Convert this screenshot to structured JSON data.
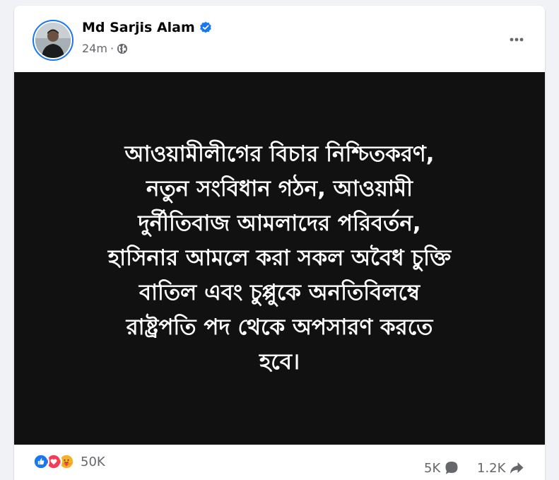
{
  "post": {
    "author": {
      "name": "Md Sarjis Alam",
      "verified": true,
      "avatar_icon": "profile-photo"
    },
    "time": "24m",
    "time_separator": "·",
    "audience_icon": "globe-icon",
    "more_icon": "more-horizontal-icon",
    "image_text": "আওয়ামীলীগের বিচার নিশ্চিতকরণ,\nনতুন সংবিধান গঠন, আওয়ামী\nদুর্নীতিবাজ আমলাদের পরিবর্তন,\nহাসিনার আমলে করা সকল অবৈধ চুক্তি\nবাতিল এবং চুপ্পুকে অনতিবিলম্বে\nরাষ্ট্রপতি পদ থেকে অপসারণ করতে\nহবে।"
  },
  "engagement": {
    "reactions": {
      "icons": [
        "like-icon",
        "love-icon",
        "care-icon"
      ],
      "count": "50K"
    },
    "comments": "5K",
    "shares": "1.2K"
  },
  "colors": {
    "brand_blue": "#1877f2",
    "love_red": "#f33e58",
    "care_yellow": "#f7b125",
    "image_background": "#111111",
    "secondary_text": "#65676b"
  }
}
